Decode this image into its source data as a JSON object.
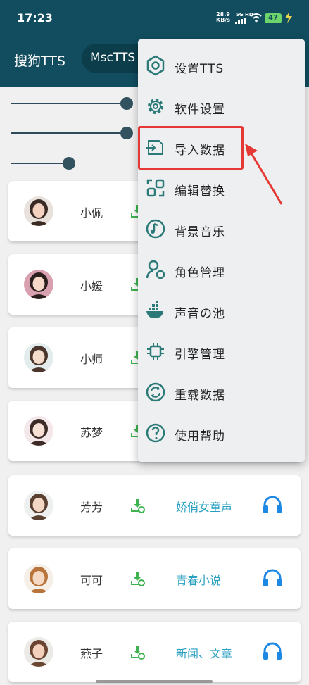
{
  "status_bar": {
    "time": "17:23",
    "net_speed": "28.9",
    "net_unit": "KB/s",
    "signal": "5G HD",
    "battery": "47"
  },
  "app_bar": {
    "title": "搜狗TTS",
    "active_tab": "MscTTS"
  },
  "sliders": [
    {
      "name": "slider-1",
      "value": 0.98
    },
    {
      "name": "slider-2",
      "value": 0.98
    },
    {
      "name": "slider-3",
      "value": 0.49
    }
  ],
  "voices": [
    {
      "name": "小佩",
      "tag": ""
    },
    {
      "name": "小媛",
      "tag": ""
    },
    {
      "name": "小师",
      "tag": ""
    },
    {
      "name": "苏梦",
      "tag": ""
    },
    {
      "name": "芳芳",
      "tag": "娇俏女童声"
    },
    {
      "name": "可可",
      "tag": "青春小说"
    },
    {
      "name": "燕子",
      "tag": "新闻、文章"
    }
  ],
  "menu": {
    "items": [
      {
        "label": "设置TTS",
        "icon": "hexagon-settings-icon"
      },
      {
        "label": "软件设置",
        "icon": "gear-icon"
      },
      {
        "label": "导入数据",
        "icon": "import-icon"
      },
      {
        "label": "编辑替换",
        "icon": "replace-icon"
      },
      {
        "label": "背景音乐",
        "icon": "music-disc-icon"
      },
      {
        "label": "角色管理",
        "icon": "user-settings-icon"
      },
      {
        "label": "声音の池",
        "icon": "docker-whale-icon"
      },
      {
        "label": "引擎管理",
        "icon": "chip-icon"
      },
      {
        "label": "重载数据",
        "icon": "reload-icon"
      },
      {
        "label": "使用帮助",
        "icon": "help-icon"
      }
    ]
  },
  "colors": {
    "app_bar": "#114d5e",
    "menu_icon": "#2b7a78",
    "download_icon": "#3fb34f",
    "tag_text": "#2aa0c0",
    "headphone_icon": "#1e88e5",
    "annotation": "#e53935"
  }
}
